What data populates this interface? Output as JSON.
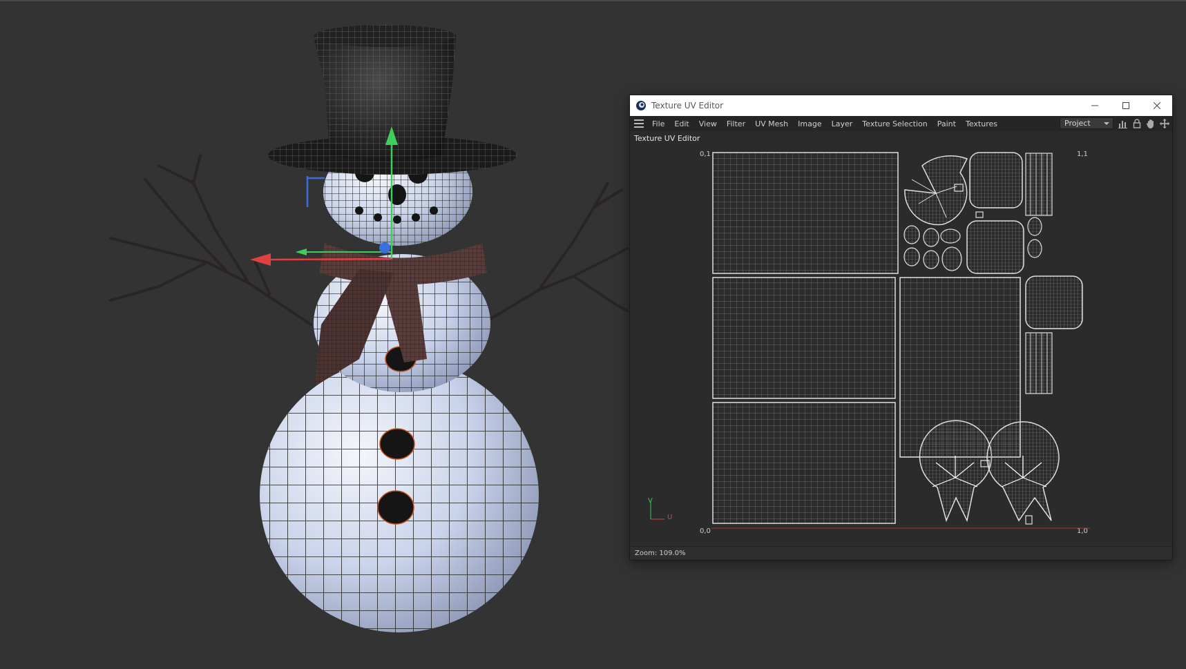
{
  "window": {
    "title": "Texture UV Editor",
    "panel_label": "Texture UV Editor"
  },
  "menu": {
    "items": [
      "File",
      "Edit",
      "View",
      "Filter",
      "UV Mesh",
      "Image",
      "Layer",
      "Texture Selection",
      "Paint",
      "Textures"
    ],
    "mode_select": "Project"
  },
  "uv_axes": {
    "top_left": "0,1",
    "top_right": "1,1",
    "bottom_left": "0,0",
    "bottom_right": "1,0",
    "v_label": "V",
    "u_label": "U"
  },
  "status": {
    "zoom": "Zoom: 109.0%"
  },
  "colors": {
    "background": "#333333",
    "accent_x": "#e04040",
    "accent_y": "#3ecf5a",
    "accent_z": "#3a6fe0"
  }
}
